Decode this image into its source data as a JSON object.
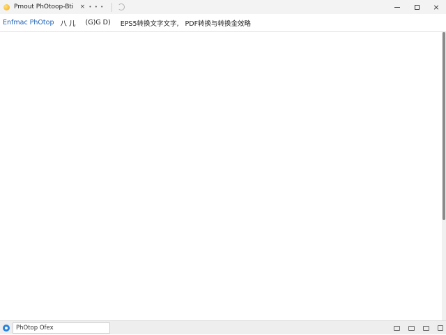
{
  "window": {
    "title": "Pmout PhOtoop-Bti",
    "tab_dots": "• • •",
    "close_glyph": "×",
    "controls": {
      "minimize": "—",
      "maximize": "□",
      "close": "×"
    }
  },
  "header": {
    "brand": "Enfmac PhOtop",
    "items": [
      "八 儿",
      "(G)G D)",
      "EPS5转换文字文字,",
      "PDF转换与转换金效略"
    ]
  },
  "taskbar": {
    "search_value": "PhOtop Ofex"
  },
  "colors": {
    "accent": "#1a5fb4",
    "start_button": "#2a82da",
    "scroll_thumb": "#8a8a8a"
  }
}
